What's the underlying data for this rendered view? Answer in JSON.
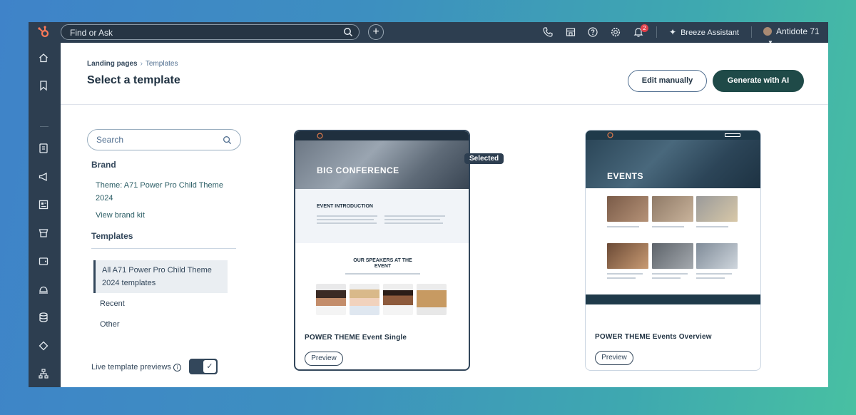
{
  "topbar": {
    "search_placeholder": "Find or Ask",
    "notification_count": "2",
    "assistant_label": "Breeze Assistant",
    "account_name": "Antidote 71"
  },
  "header": {
    "breadcrumb_parent": "Landing pages",
    "breadcrumb_current": "Templates",
    "title": "Select a template",
    "edit_manually_label": "Edit manually",
    "generate_ai_label": "Generate with AI"
  },
  "filters": {
    "search_placeholder": "Search",
    "brand_heading": "Brand",
    "theme_link": "Theme: A71 Power Pro Child Theme 2024",
    "brand_kit_link": "View brand kit",
    "templates_heading": "Templates",
    "items": [
      {
        "label": "All A71 Power Pro Child Theme 2024 templates",
        "active": true
      },
      {
        "label": "Recent",
        "active": false
      },
      {
        "label": "Other",
        "active": false
      }
    ],
    "live_previews_label": "Live template previews",
    "live_previews_on": true
  },
  "cards": [
    {
      "name": "POWER THEME Event Single",
      "preview_label": "Preview",
      "selected": true,
      "selected_label": "Selected",
      "thumb": {
        "hero_title": "BIG CONFERENCE",
        "section1": "EVENT INTRODUCTION",
        "section2_line1": "OUR SPEAKERS AT THE",
        "section2_line2": "EVENT"
      }
    },
    {
      "name": "POWER THEME Events Overview",
      "preview_label": "Preview",
      "selected": false,
      "thumb": {
        "hero_title": "EVENTS"
      }
    }
  ],
  "colors": {
    "nav_bg": "#2d3e50",
    "primary_button": "#1f4a48",
    "link": "#2c5e66"
  }
}
